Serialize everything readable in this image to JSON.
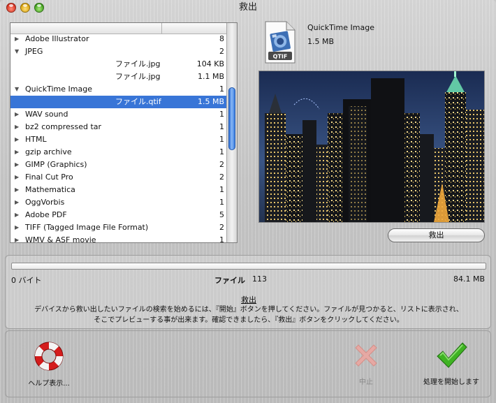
{
  "window": {
    "title": "救出"
  },
  "list": {
    "rows": [
      {
        "type": "group",
        "expanded": false,
        "name": "Adobe Illustrator",
        "count": "8"
      },
      {
        "type": "group",
        "expanded": true,
        "name": "JPEG",
        "count": "2"
      },
      {
        "type": "child",
        "name": "ファイル.jpg",
        "count": "104 KB"
      },
      {
        "type": "child",
        "name": "ファイル.jpg",
        "count": "1.1 MB"
      },
      {
        "type": "group",
        "expanded": true,
        "name": "QuickTime Image",
        "count": "1"
      },
      {
        "type": "child",
        "selected": true,
        "name": "ファイル.qtif",
        "count": "1.5 MB"
      },
      {
        "type": "group",
        "expanded": false,
        "name": "WAV sound",
        "count": "1"
      },
      {
        "type": "group",
        "expanded": false,
        "name": "bz2 compressed tar",
        "count": "1"
      },
      {
        "type": "group",
        "expanded": false,
        "name": "HTML",
        "count": "1"
      },
      {
        "type": "group",
        "expanded": false,
        "name": "gzip archive",
        "count": "1"
      },
      {
        "type": "group",
        "expanded": false,
        "name": "GIMP (Graphics)",
        "count": "2"
      },
      {
        "type": "group",
        "expanded": false,
        "name": "Final Cut Pro",
        "count": "2"
      },
      {
        "type": "group",
        "expanded": false,
        "name": "Mathematica",
        "count": "1"
      },
      {
        "type": "group",
        "expanded": false,
        "name": "OggVorbis",
        "count": "1"
      },
      {
        "type": "group",
        "expanded": false,
        "name": "Adobe PDF",
        "count": "5"
      },
      {
        "type": "group",
        "expanded": false,
        "name": "TIFF (Tagged Image File Format)",
        "count": "2"
      },
      {
        "type": "group",
        "expanded": false,
        "name": "WMV & ASF movie",
        "count": "1"
      }
    ]
  },
  "preview": {
    "icon_label": "QTIF",
    "file_name": "QuickTime Image",
    "file_size": "1.5 MB",
    "rescue_button": "救出"
  },
  "status": {
    "progress": 0,
    "size_left": "0 バイト",
    "files_label": "ファイル",
    "files_count": "113",
    "size_right": "84.1 MB",
    "desc_title": "救出",
    "desc_line1": "デバイスから救い出したいファイルの検索を始めるには、『開始』ボタンを押してください。ファイルが見つかると、リストに表示され、",
    "desc_line2": "そこでプレビューする事が出来ます。確認できましたら、『救出』ボタンをクリックしてください。"
  },
  "toolbar": {
    "help_label": "ヘルプ表示...",
    "stop_label": "中止",
    "start_label": "処理を開始します"
  },
  "colors": {
    "selection": "#3875d7",
    "accent_green": "#2f9a1a",
    "lifebuoy_red": "#d41c1c"
  }
}
